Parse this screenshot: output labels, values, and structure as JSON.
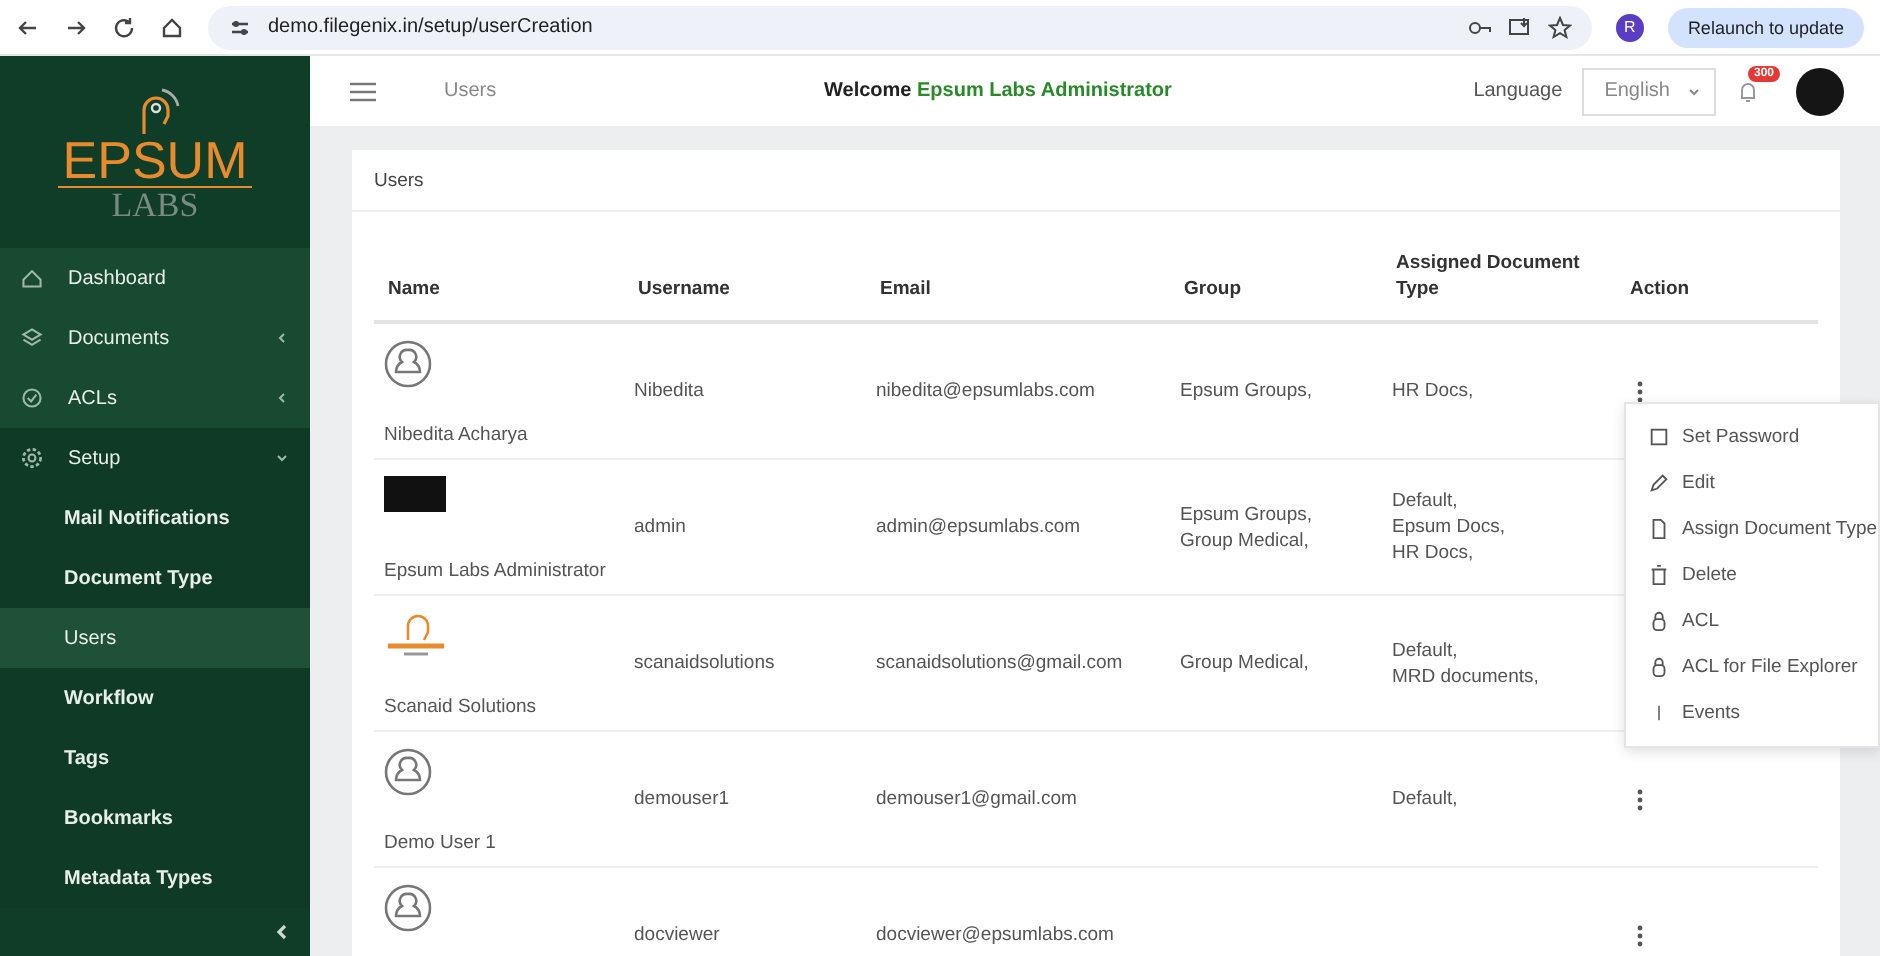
{
  "browser": {
    "url": "demo.filegenix.in/setup/userCreation",
    "profile": "R",
    "update_button": "Relaunch to update"
  },
  "logo": {
    "title": "EPSUM",
    "subtitle": "LABS"
  },
  "sidebar": {
    "items": [
      {
        "label": "Dashboard",
        "expandable": false,
        "expanded": false
      },
      {
        "label": "Documents",
        "expandable": true,
        "expanded": false
      },
      {
        "label": "ACLs",
        "expandable": true,
        "expanded": false
      },
      {
        "label": "Setup",
        "expandable": true,
        "expanded": true,
        "children": [
          {
            "label": "Mail Notifications",
            "selected": false
          },
          {
            "label": "Document Type",
            "selected": false
          },
          {
            "label": "Users",
            "selected": true
          },
          {
            "label": "Workflow",
            "selected": false
          },
          {
            "label": "Tags",
            "selected": false
          },
          {
            "label": "Bookmarks",
            "selected": false
          },
          {
            "label": "Metadata Types",
            "selected": false
          }
        ]
      }
    ]
  },
  "header": {
    "breadcrumb": "Users",
    "welcome": "Welcome **Epsum Labs Administrator**",
    "language_label": "Language",
    "language": "English",
    "notification_count": "300"
  },
  "card": {
    "title": "Users"
  },
  "table": {
    "columns": [
      "Name",
      "Username",
      "Email",
      "Group",
      "Assigned Document Type",
      "Action"
    ],
    "rows": [
      {
        "kind": "person",
        "name": "Nibedita Acharya",
        "username": "Nibedita",
        "email": "nibedita@epsumlabs.com",
        "groups": [
          "Epsum Groups,"
        ],
        "document_types": [
          "HR Docs,"
        ],
        "action_icon": true
      },
      {
        "kind": "photo",
        "name": "Epsum Labs Administrator",
        "username": "admin",
        "email": "admin@epsumlabs.com",
        "groups": [
          "Epsum Groups,",
          "Group Medical,"
        ],
        "document_types": [
          "Default,",
          "Epsum Docs,",
          "HR Docs,"
        ]
      },
      {
        "kind": "logo",
        "name": "Scanaid Solutions",
        "username": "scanaidsolutions",
        "email": "scanaidsolutions@gmail.com",
        "groups": [
          "Group Medical,"
        ],
        "document_types": [
          "Default,",
          "MRD documents,"
        ]
      },
      {
        "kind": "person",
        "name": "Demo User 1",
        "username": "demouser1",
        "email": "demouser1@gmail.com",
        "groups": [],
        "document_types": [
          "Default,"
        ],
        "action_icon": true
      },
      {
        "kind": "person",
        "username": "docviewer",
        "email": "docviewer@epsumlabs.com",
        "groups": [],
        "document_types": [],
        "action_icon": true
      }
    ]
  },
  "action_menu": {
    "items": [
      {
        "kind": "square",
        "label": "Set Password"
      },
      {
        "kind": "pencil",
        "label": "Edit"
      },
      {
        "kind": "document",
        "label": "Assign Document Type"
      },
      {
        "kind": "trash",
        "label": "Delete"
      },
      {
        "kind": "lock",
        "label": "ACL"
      },
      {
        "kind": "lock",
        "label": "ACL for File Explorer"
      },
      {
        "kind": "bar",
        "label": "Events"
      }
    ]
  }
}
